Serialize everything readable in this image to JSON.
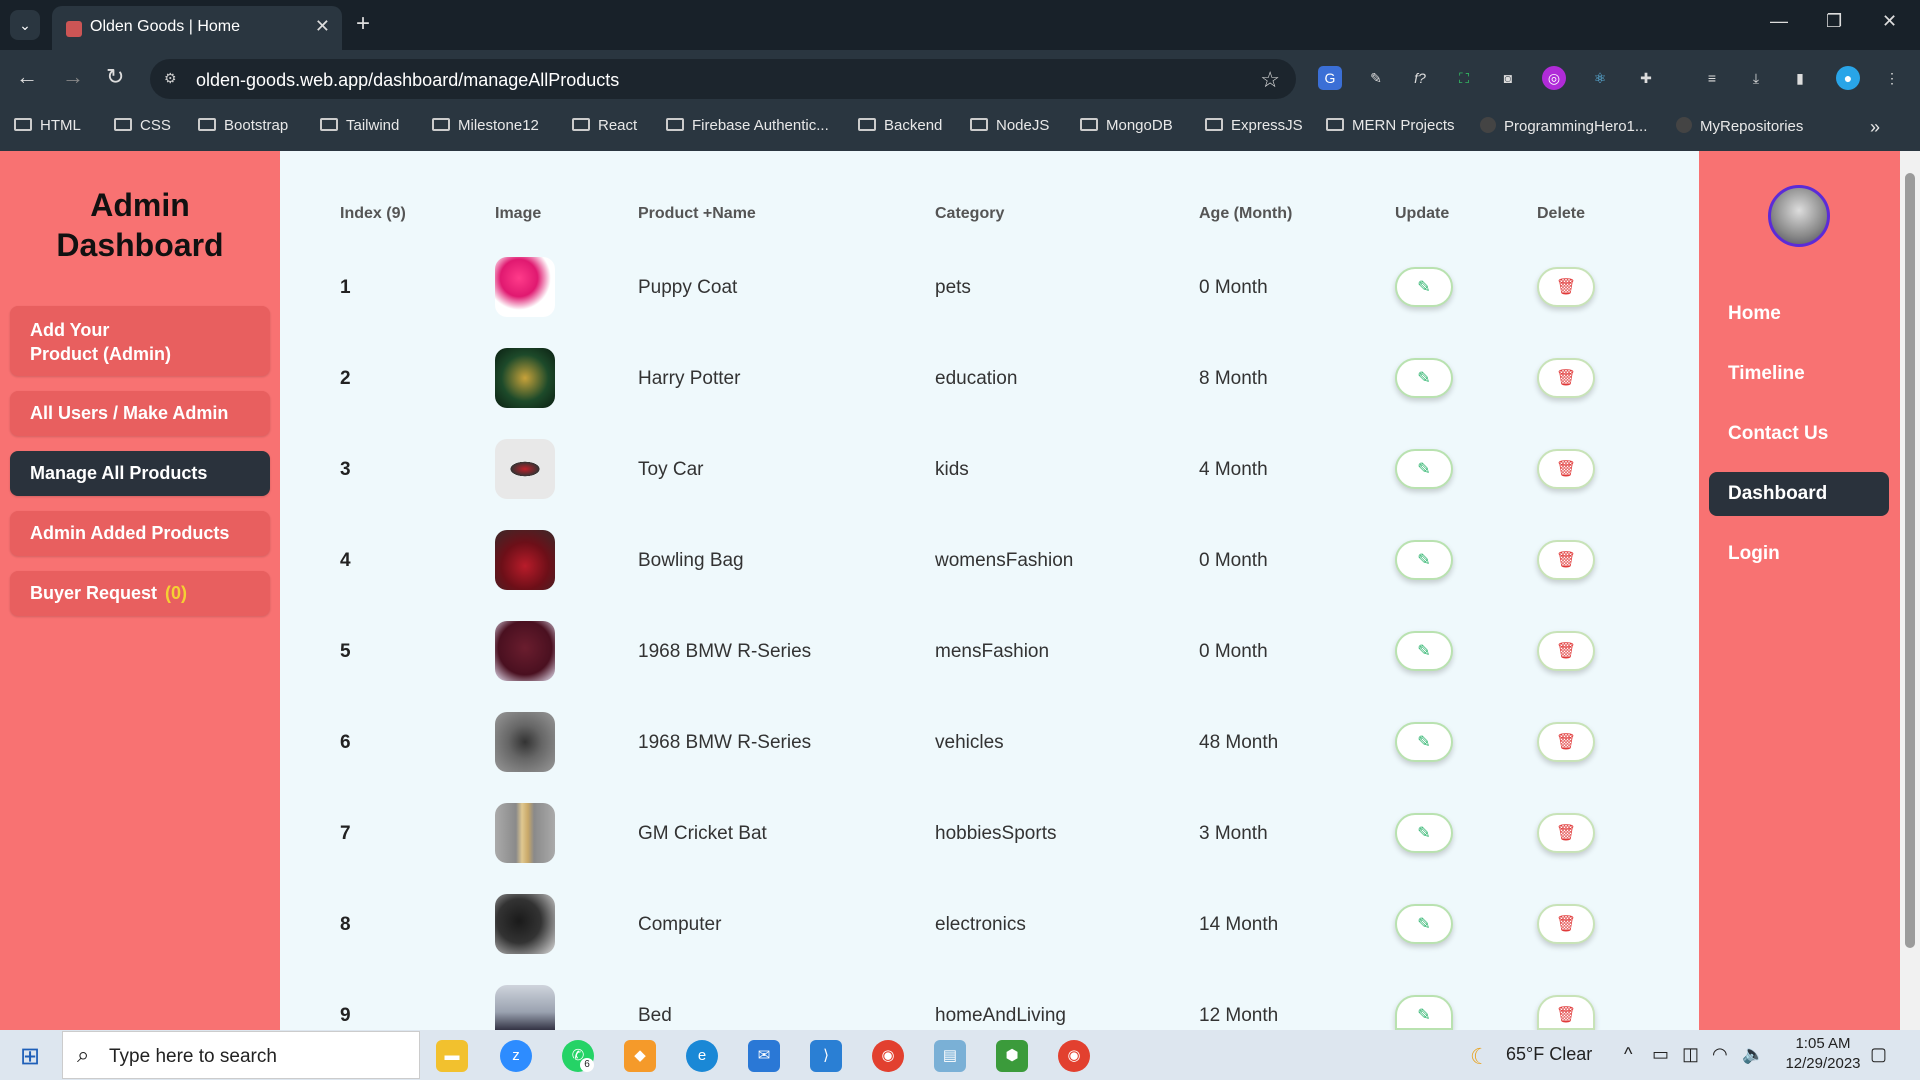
{
  "browser": {
    "tab_title": "Olden Goods | Home",
    "url": "olden-goods.web.app/dashboard/manageAllProducts",
    "bookmarks": [
      "HTML",
      "CSS",
      "Bootstrap",
      "Tailwind",
      "Milestone12",
      "React",
      "Firebase Authentic...",
      "Backend",
      "NodeJS",
      "MongoDB",
      "ExpressJS",
      "MERN Projects",
      "ProgrammingHero1...",
      "MyRepositories"
    ]
  },
  "sidebar": {
    "title_line1": "Admin",
    "title_line2": "Dashboard",
    "add_product_line1": "Add Your",
    "add_product_line2": "Product (Admin)",
    "all_users": "All Users / Make Admin",
    "manage_products": "Manage All Products",
    "admin_added": "Admin Added Products",
    "buyer_request": "Buyer Request",
    "buyer_request_count": "(0)"
  },
  "table": {
    "headers": {
      "index": "Index (9)",
      "image": "Image",
      "name": "Product +Name",
      "category": "Category",
      "age": "Age (Month)",
      "update": "Update",
      "delete": "Delete"
    },
    "rows": [
      {
        "index": "1",
        "name": "Puppy Coat",
        "category": "pets",
        "age": "0 Month"
      },
      {
        "index": "2",
        "name": "Harry Potter",
        "category": "education",
        "age": "8 Month"
      },
      {
        "index": "3",
        "name": "Toy Car",
        "category": "kids",
        "age": "4 Month"
      },
      {
        "index": "4",
        "name": "Bowling Bag",
        "category": "womensFashion",
        "age": "0 Month"
      },
      {
        "index": "5",
        "name": "1968 BMW R-Series",
        "category": "mensFashion",
        "age": "0 Month"
      },
      {
        "index": "6",
        "name": "1968 BMW R-Series",
        "category": "vehicles",
        "age": "48 Month"
      },
      {
        "index": "7",
        "name": "GM Cricket Bat",
        "category": "hobbiesSports",
        "age": "3 Month"
      },
      {
        "index": "8",
        "name": "Computer",
        "category": "electronics",
        "age": "14 Month"
      },
      {
        "index": "9",
        "name": "Bed",
        "category": "homeAndLiving",
        "age": "12 Month"
      }
    ]
  },
  "rightnav": {
    "home": "Home",
    "timeline": "Timeline",
    "contact": "Contact Us",
    "dashboard": "Dashboard",
    "login": "Login"
  },
  "taskbar": {
    "search_placeholder": "Type here to search",
    "weather": "65°F  Clear",
    "time": "1:05 AM",
    "date": "12/29/2023",
    "whatsapp_badge": "6"
  },
  "colors": {
    "sidebar": "#f87272",
    "active": "#2a323c",
    "main_bg": "#eff9fc",
    "badge_yellow": "#f5d033"
  }
}
